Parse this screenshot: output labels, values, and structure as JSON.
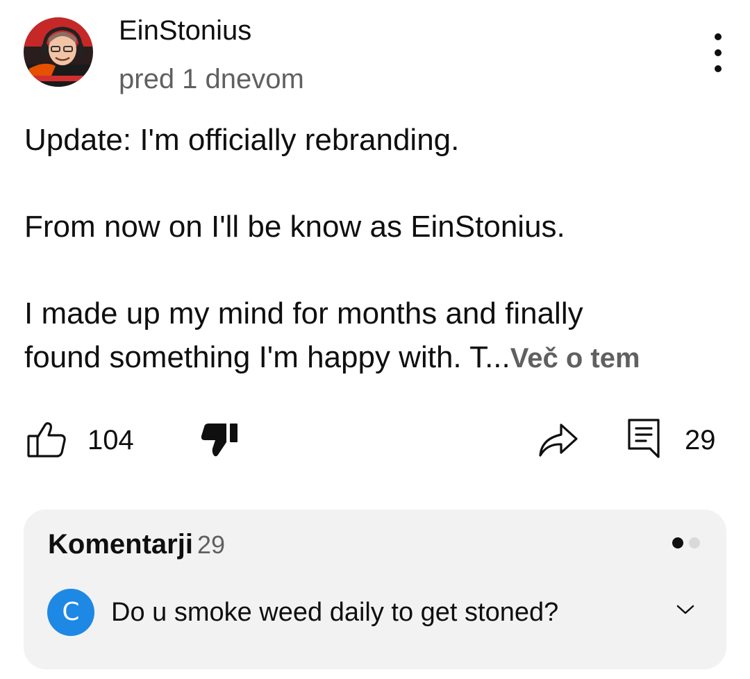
{
  "post": {
    "author": "EinStonius",
    "time": "pred 1 dnevom",
    "lines": [
      "Update: I'm officially rebranding.",
      "From now on I'll be know as EinStonius.",
      "I made up my mind for months and finally",
      "found something I'm happy with. T..."
    ],
    "more_label": "Več o tem"
  },
  "actions": {
    "likes": "104",
    "comments": "29"
  },
  "comments": {
    "title": "Komentarji",
    "count": "29",
    "top_comment": {
      "avatar_letter": "C",
      "text": "Do u smoke weed daily to get stoned?"
    }
  },
  "colors": {
    "text": "#0f0f0f",
    "secondary": "#606060",
    "panel": "#f2f2f2",
    "avatar_blue": "#1e88e5"
  }
}
